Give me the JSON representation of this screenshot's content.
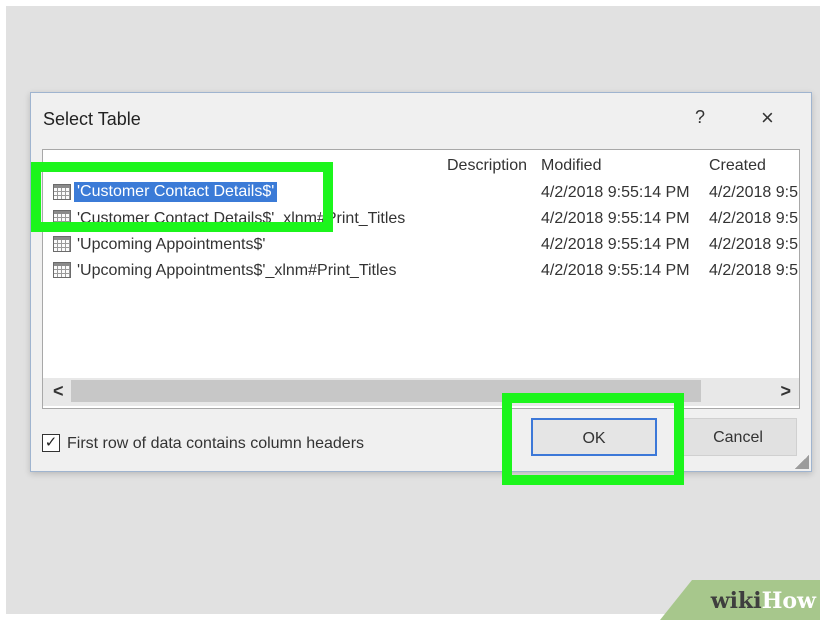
{
  "dialog": {
    "title": "Select Table",
    "help_label": "?",
    "close_label": "×"
  },
  "columns": {
    "description": "Description",
    "modified": "Modified",
    "created": "Created"
  },
  "rows": [
    {
      "name": "'Customer Contact Details$'",
      "modified": "4/2/2018 9:55:14 PM",
      "created": "4/2/2018 9:5",
      "selected": true
    },
    {
      "name": "'Customer Contact Details$'_xlnm#Print_Titles",
      "modified": "4/2/2018 9:55:14 PM",
      "created": "4/2/2018 9:5",
      "selected": false
    },
    {
      "name": "'Upcoming Appointments$'",
      "modified": "4/2/2018 9:55:14 PM",
      "created": "4/2/2018 9:5",
      "selected": false
    },
    {
      "name": "'Upcoming Appointments$'_xlnm#Print_Titles",
      "modified": "4/2/2018 9:55:14 PM",
      "created": "4/2/2018 9:5",
      "selected": false
    }
  ],
  "scrollbar": {
    "left_arrow": "<",
    "right_arrow": ">"
  },
  "checkbox": {
    "label": "First row of data contains column headers",
    "checked": true,
    "mark": "✓"
  },
  "buttons": {
    "ok": "OK",
    "cancel": "Cancel"
  },
  "watermark": {
    "part1": "wiki",
    "part2": "How"
  },
  "colors": {
    "highlight": "#1cf51c",
    "selection": "#3b7bd7",
    "ok_border": "#3c78d8"
  }
}
